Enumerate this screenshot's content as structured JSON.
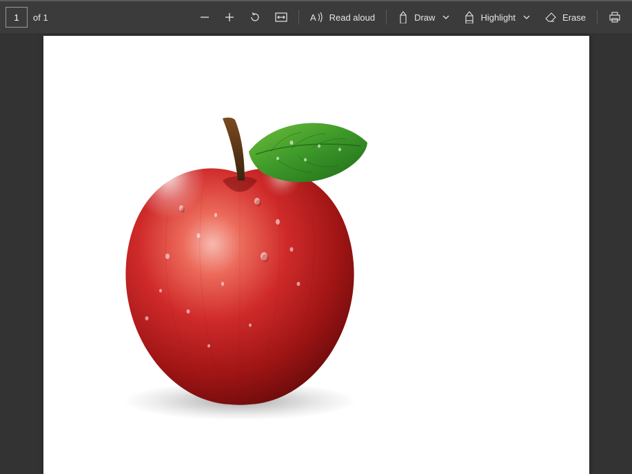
{
  "toolbar": {
    "page_input_value": "1",
    "page_of_label": "of 1",
    "read_aloud_label": "Read aloud",
    "draw_label": "Draw",
    "highlight_label": "Highlight",
    "erase_label": "Erase"
  },
  "icons": {
    "zoom_out": "zoom-out-icon",
    "zoom_in": "zoom-in-icon",
    "rotate": "rotate-icon",
    "fit": "fit-page-icon",
    "read_aloud": "read-aloud-icon",
    "draw": "draw-icon",
    "chevron_down": "chevron-down-icon",
    "highlight": "highlight-icon",
    "erase": "erase-icon",
    "print": "print-icon"
  },
  "document": {
    "content_description": "red-apple-with-leaf"
  }
}
